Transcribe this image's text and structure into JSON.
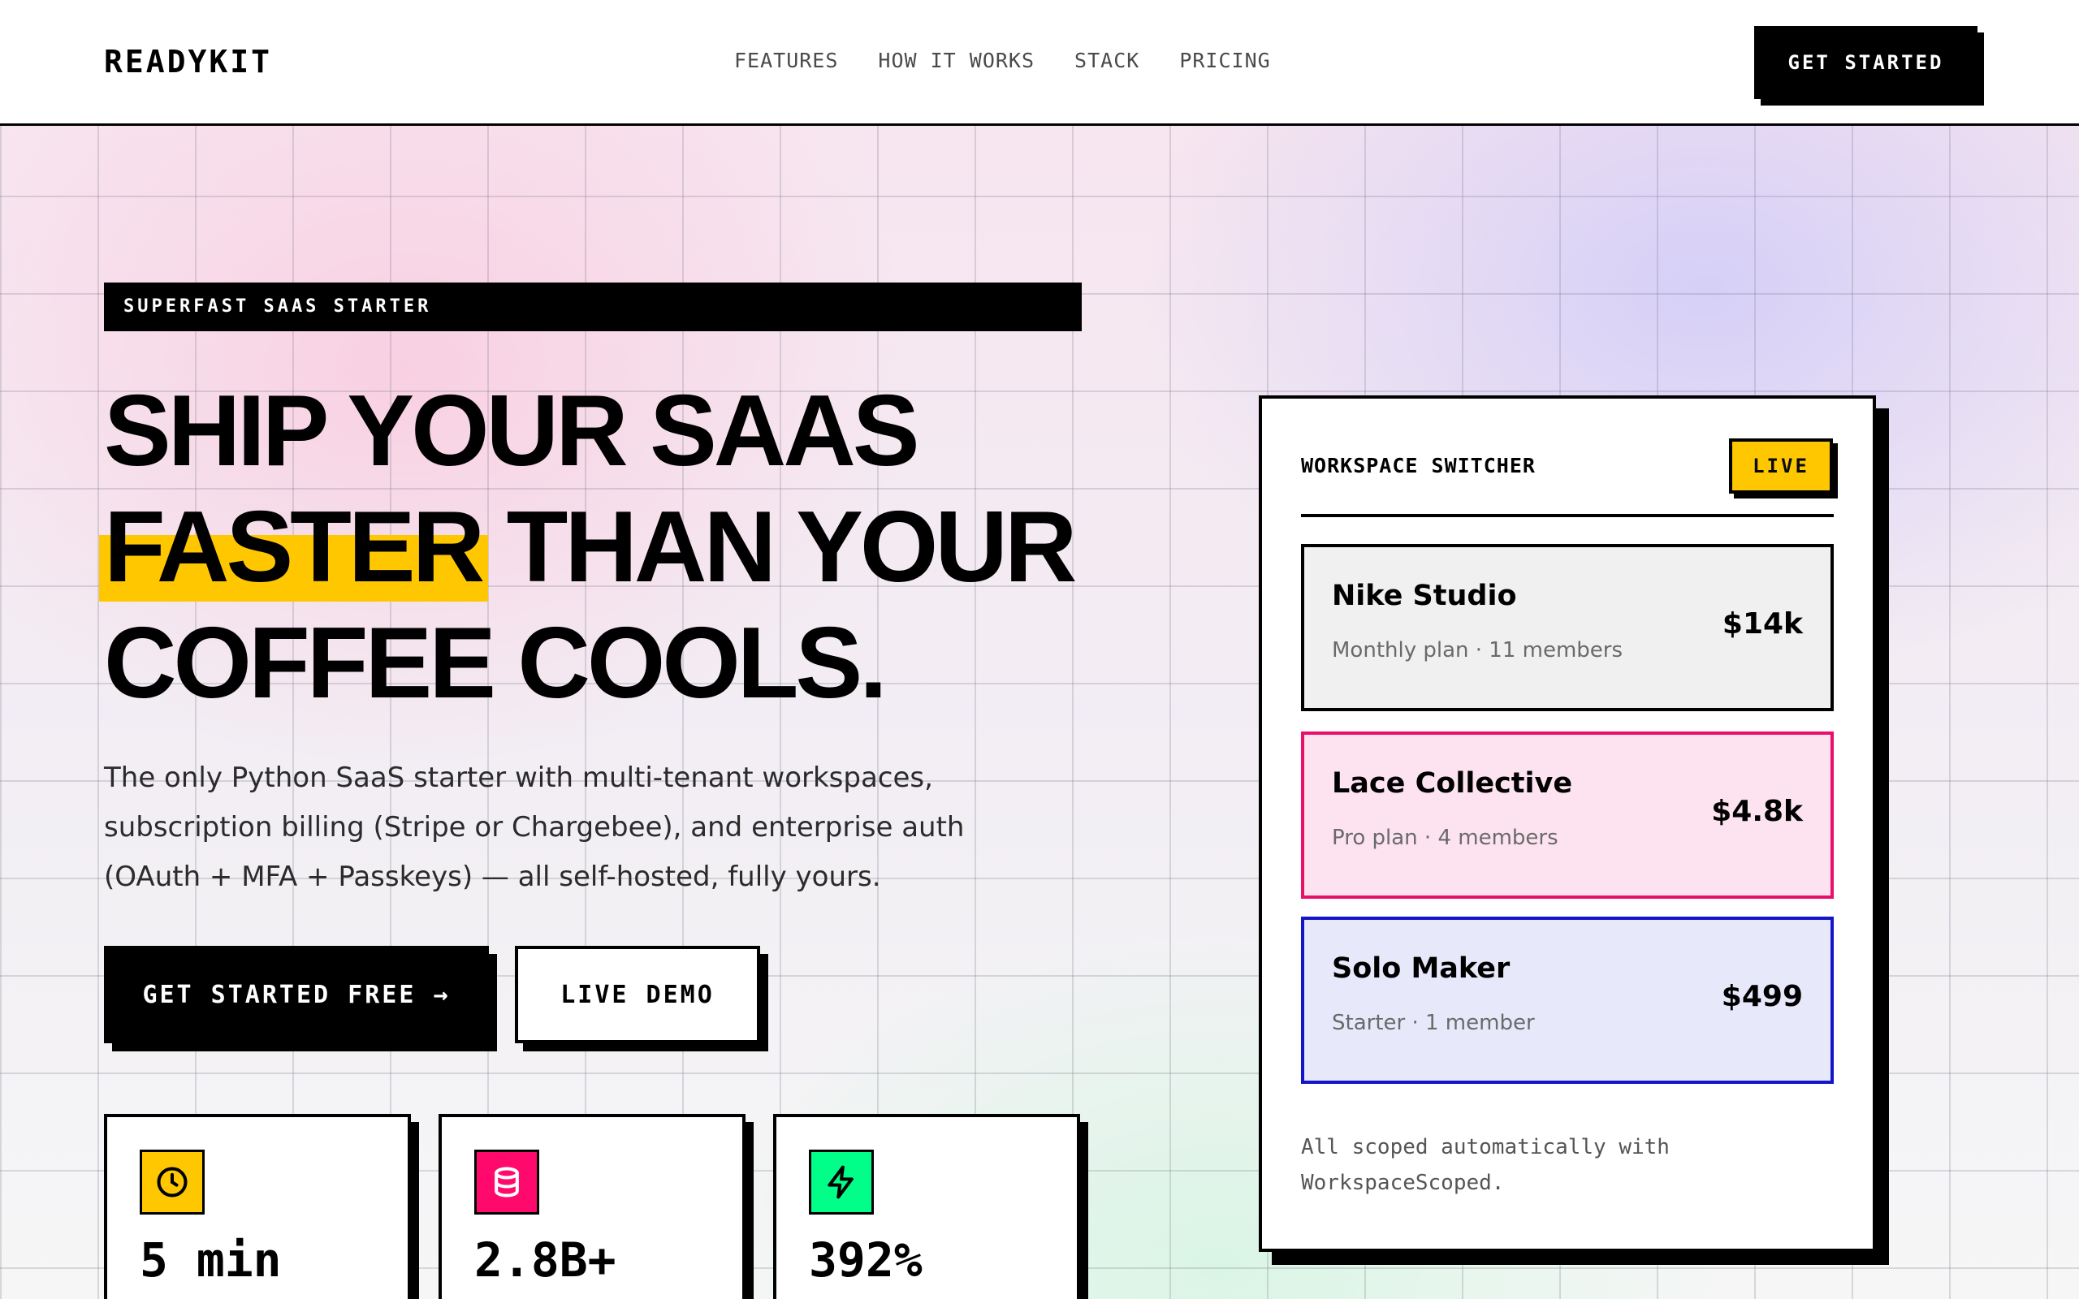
{
  "nav": {
    "logo": "READYKIT",
    "links": [
      "FEATURES",
      "HOW IT WORKS",
      "STACK",
      "PRICING"
    ],
    "cta": "GET STARTED"
  },
  "hero": {
    "eyebrow": "SUPERFAST SAAS STARTER",
    "headline": {
      "line1": "SHIP YOUR SAAS",
      "highlight": "FASTER",
      "line2_rest": " THAN YOUR",
      "line3": "COFFEE COOLS."
    },
    "subtext": "The only Python SaaS starter with multi-tenant workspaces, subscription billing (Stripe or Chargebee), and enterprise auth (OAuth + MFA + Passkeys) — all self-hosted, fully yours.",
    "primary_button": "GET STARTED FREE →",
    "secondary_button": "LIVE DEMO",
    "stats": [
      {
        "icon": "clock-icon",
        "value": "5 min",
        "color": "#ffc700"
      },
      {
        "icon": "database-icon",
        "value": "2.8B+",
        "color": "#ff0a6c"
      },
      {
        "icon": "lightning-icon",
        "value": "392%",
        "color": "#00ff88"
      }
    ]
  },
  "workspace": {
    "title": "WORKSPACE SWITCHER",
    "badge": "LIVE",
    "items": [
      {
        "name": "Nike Studio",
        "meta": "Monthly plan · 11 members",
        "price": "$14k",
        "bg": "#f0f0f0",
        "border": "#000000"
      },
      {
        "name": "Lace Collective",
        "meta": "Pro plan · 4 members",
        "price": "$4.8k",
        "bg": "#fde3ef",
        "border": "#e8106b"
      },
      {
        "name": "Solo Maker",
        "meta": "Starter · 1 member",
        "price": "$499",
        "bg": "#e8e8fb",
        "border": "#1414c8"
      }
    ],
    "footnote": "All scoped automatically with WorkspaceScoped."
  },
  "colors": {
    "accent_yellow": "#ffc700",
    "ink": "#000000"
  }
}
